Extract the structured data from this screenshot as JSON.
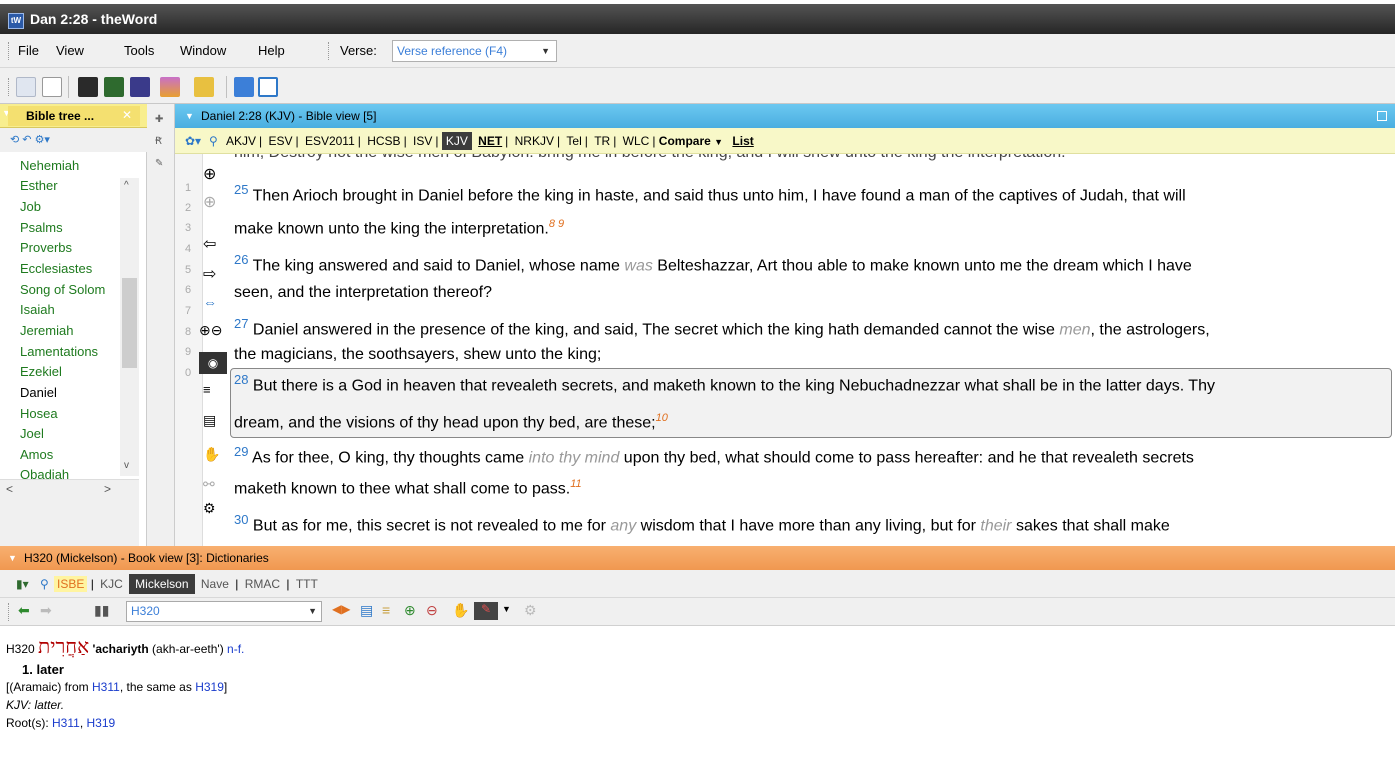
{
  "window": {
    "title": "Dan 2:28 - theWord",
    "app_icon": "tW"
  },
  "menu": [
    "File",
    "View",
    "Tools",
    "Window",
    "Help"
  ],
  "verse": {
    "label": "Verse:",
    "placeholder": "Verse reference (F4)"
  },
  "left_panel": {
    "tab_label": "Bible tree ...",
    "books": [
      "Nehemiah",
      "Esther",
      "Job",
      "Psalms",
      "Proverbs",
      "Ecclesiastes",
      "Song of Solom",
      "Isaiah",
      "Jeremiah",
      "Lamentations",
      "Ezekiel",
      "Daniel",
      "Hosea",
      "Joel",
      "Amos",
      "Obadiah"
    ],
    "selected_book": "Daniel",
    "scroll_left": "<",
    "scroll_right": ">"
  },
  "row_numbers": [
    "1",
    "2",
    "3",
    "4",
    "5",
    "6",
    "7",
    "8",
    "9",
    "0"
  ],
  "bible_view": {
    "title": "Daniel 2:28 (KJV) - Bible view [5]",
    "versions": [
      "AKJV",
      "ESV",
      "ESV2011",
      "HCSB",
      "ISV",
      "KJV",
      "NET",
      "NRKJV",
      "Tel",
      "TR",
      "WLC"
    ],
    "selected_version": "KJV",
    "compare": "Compare",
    "list": "List",
    "top_partial": "him, Destroy not the wise men of Babylon: bring me in before the king, and I will shew unto the king the interpretation.",
    "verses": [
      {
        "num": "25",
        "line1": "Then Arioch brought in Daniel before the king in haste, and said thus unto him, I have found a man of the captives of Judah, that will",
        "line2": "make known unto the king the interpretation.",
        "fn": "8 9"
      },
      {
        "num": "26",
        "line1a": "The king answered and said to Daniel, whose name ",
        "italic": "was",
        "line1b": " Belteshazzar, Art thou able to make known unto me the dream which I have",
        "line2": "seen, and the interpretation thereof?"
      },
      {
        "num": "27",
        "line1a": "Daniel answered in the presence of the king, and said, The secret which the king hath demanded cannot the wise ",
        "italic": "men",
        "line1b": ", the astrologers,",
        "line2": "the magicians, the soothsayers, shew unto the king;"
      },
      {
        "num": "28",
        "line1": "But there is a God in heaven that revealeth secrets, and maketh known to the king Nebuchadnezzar what shall be in the latter days. Thy",
        "line2": "dream, and the visions of thy head upon thy bed, are these;",
        "fn": "10"
      },
      {
        "num": "29",
        "line1a": "As for thee, O king, thy thoughts came ",
        "italic": "into thy mind",
        "line1b": " upon thy bed, what should come to pass hereafter: and he that revealeth secrets",
        "line2": "maketh known to thee what shall come to pass.",
        "fn": "11"
      },
      {
        "num": "30",
        "line1a": "But as for me, this secret is not revealed to me for ",
        "italic": "any",
        "line1b": " wisdom that I have more than any living, but for ",
        "italic2": "their",
        "line1c": " sakes that shall make"
      }
    ]
  },
  "book_view": {
    "title": "H320 (Mickelson) - Book view [3]: Dictionaries",
    "tabs": [
      "ISBE",
      "KJC",
      "Mickelson",
      "Nave",
      "RMAC",
      "TTT"
    ],
    "selected_tab": "Mickelson",
    "lookup": "H320",
    "entry": {
      "num": "H320",
      "hebrew": "אַחֲרִית",
      "translit": "'achariyth",
      "pron": "(akh-ar-eeth')",
      "pos": "n-f.",
      "def": "1. later",
      "origin_a": "[(Aramaic) from ",
      "ref1": "H311",
      "origin_b": ", the same as ",
      "ref2": "H319",
      "origin_c": "]",
      "kjv": "KJV: latter.",
      "roots_label": "Root(s): ",
      "roots": [
        "H311",
        "H319"
      ]
    }
  }
}
